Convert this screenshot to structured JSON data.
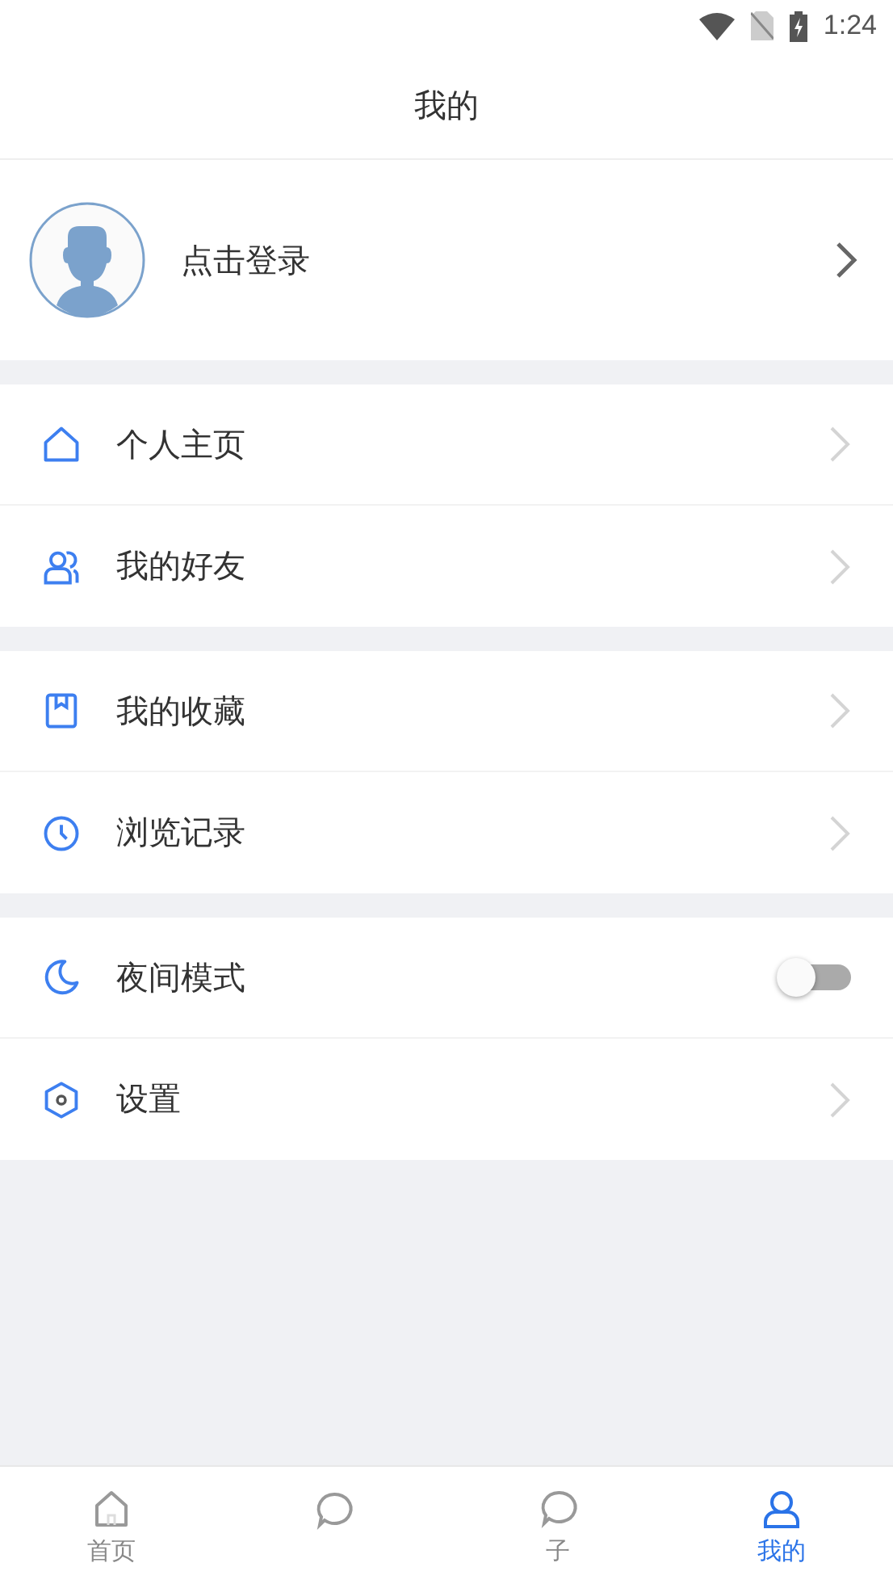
{
  "status_bar": {
    "time": "1:24"
  },
  "header": {
    "title": "我的"
  },
  "profile": {
    "label": "点击登录"
  },
  "groups": [
    [
      {
        "kind": "link",
        "label": "个人主页"
      },
      {
        "kind": "link",
        "label": "我的好友"
      }
    ],
    [
      {
        "kind": "link",
        "label": "我的收藏"
      },
      {
        "kind": "link",
        "label": "浏览记录"
      }
    ],
    [
      {
        "kind": "toggle",
        "label": "夜间模式",
        "on": false
      },
      {
        "kind": "link",
        "label": "设置"
      }
    ]
  ],
  "tabs": [
    {
      "label": "首页",
      "selected": false
    },
    {
      "selected": false
    },
    {
      "label": "子",
      "selected": false
    },
    {
      "label": "我的",
      "selected": true
    }
  ]
}
